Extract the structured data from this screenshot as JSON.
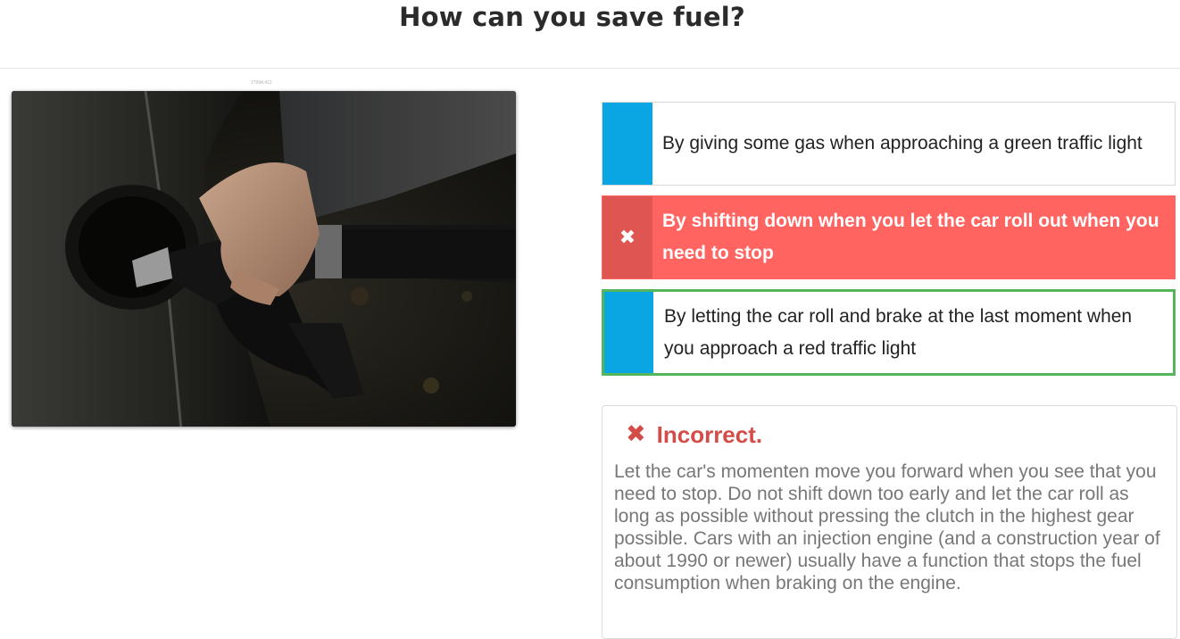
{
  "page": {
    "title": "How can you save fuel?",
    "image_caption": "27994.412"
  },
  "options": [
    {
      "label": "By giving some gas when approaching a green traffic light",
      "state": "default"
    },
    {
      "label": "By shifting down when you let the car roll out when you need to stop",
      "state": "selected-wrong",
      "icon": "x-icon"
    },
    {
      "label": "By letting the car roll and brake at the last moment when you approach a red traffic light",
      "state": "correct-highlight"
    }
  ],
  "feedback": {
    "icon": "x-icon",
    "title": "Incorrect.",
    "text": "Let the car's momenten move you forward when you see that you need to stop. Do not shift down too early and let the car roll as long as possible without pressing the clutch in the highest gear possible. Cars with an injection engine (and a construction year of about 1990 or newer) usually have a function that stops the fuel consumption when braking on the engine."
  },
  "colors": {
    "marker_blue": "#0aa5e3",
    "wrong_red": "#ff6461",
    "wrong_red_dark": "#df5552",
    "correct_green": "#55b55c",
    "feedback_red": "#d44c47"
  }
}
